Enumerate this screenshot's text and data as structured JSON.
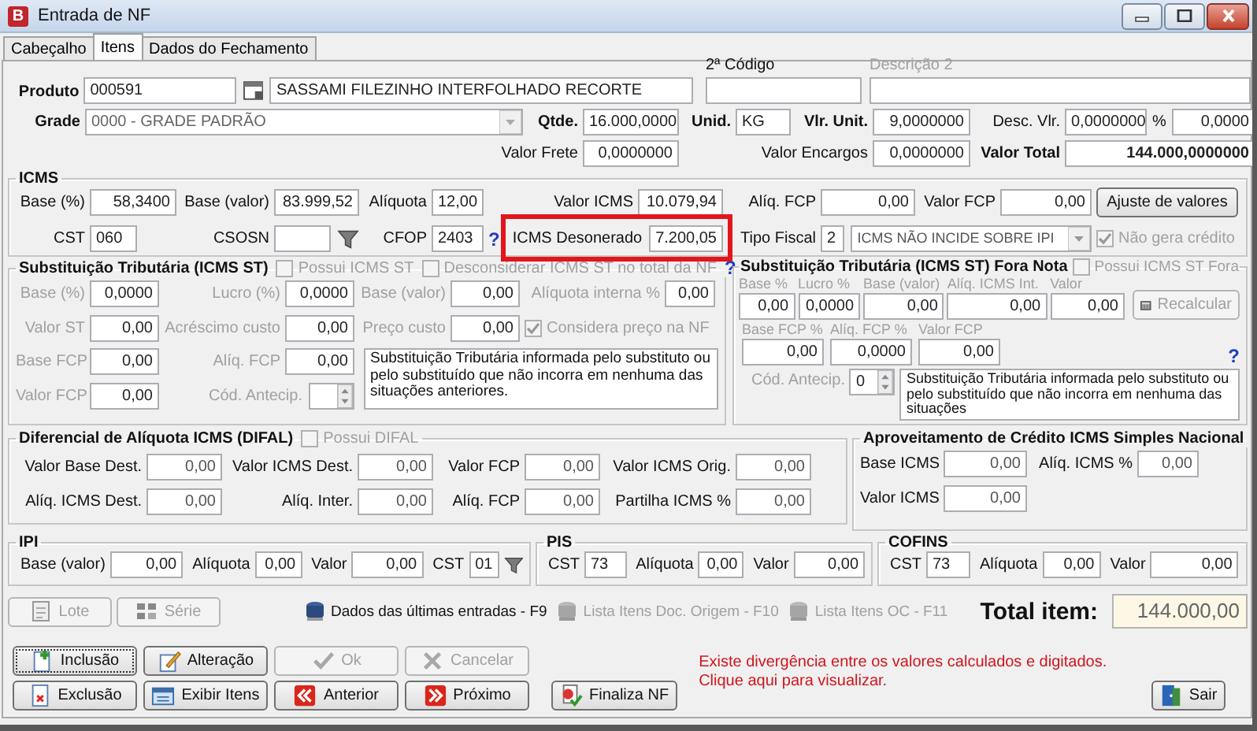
{
  "window": {
    "logo": "B",
    "title": "Entrada de NF"
  },
  "tabs": [
    {
      "label": "Cabeçalho",
      "selected": false
    },
    {
      "label": "Itens",
      "selected": true
    },
    {
      "label": "Dados do Fechamento",
      "selected": false
    }
  ],
  "produto": {
    "label": "Produto",
    "code": "000591",
    "description": "SASSAMI FILEZINHO INTERFOLHADO RECORTE"
  },
  "segundo_codigo": {
    "label": "2ª Código"
  },
  "descricao_2": {
    "label": "Descrição 2",
    "disabled": true
  },
  "grade": {
    "label": "Grade",
    "value": "0000 - GRADE PADRÃO"
  },
  "qtde": {
    "label": "Qtde.",
    "value": "16.000,0000"
  },
  "unid": {
    "label": "Unid.",
    "value": "KG"
  },
  "vlr_unit": {
    "label": "Vlr. Unit.",
    "value": "9,0000000"
  },
  "desc_vlr": {
    "label": "Desc. Vlr.",
    "value": "0,0000000"
  },
  "desc_pct": {
    "label": "%",
    "value": "0,0000"
  },
  "valor_frete": {
    "label": "Valor Frete",
    "value": "0,0000000"
  },
  "valor_encargos": {
    "label": "Valor Encargos",
    "value": "0,0000000"
  },
  "valor_total": {
    "label": "Valor Total",
    "value": "144.000,0000000"
  },
  "icms": {
    "title": "ICMS",
    "base_pct": {
      "label": "Base (%)",
      "value": "58,3400"
    },
    "base_valor": {
      "label": "Base (valor)",
      "value": "83.999,52"
    },
    "aliquota": {
      "label": "Alíquota",
      "value": "12,00"
    },
    "valor_icms": {
      "label": "Valor ICMS",
      "value": "10.079,94"
    },
    "aliq_fcp": {
      "label": "Alíq. FCP",
      "value": "0,00"
    },
    "valor_fcp": {
      "label": "Valor FCP",
      "value": "0,00"
    },
    "ajuste_button": "Ajuste de valores",
    "cst": {
      "label": "CST",
      "value": "060"
    },
    "csosn": {
      "label": "CSOSN"
    },
    "cfop": {
      "label": "CFOP",
      "value": "2403"
    },
    "help": "?",
    "icms_desonerado": {
      "label": "ICMS Desonerado",
      "value": "7.200,05",
      "highlighted": true
    },
    "tipo_fiscal": {
      "label": "Tipo Fiscal",
      "code": "2",
      "value": "ICMS NÃO INCIDE SOBRE IPI"
    },
    "nao_gera_credito": {
      "label": "Não gera crédito",
      "checked": true,
      "disabled": true
    }
  },
  "st": {
    "title": "Substituição Tributária (ICMS ST)",
    "disabled": true,
    "possui": {
      "label": "Possui ICMS ST",
      "checked": false,
      "disabled": true
    },
    "desconsiderar": {
      "label": "Desconsiderar ICMS ST no total da NF",
      "checked": false,
      "disabled": true
    },
    "help": "?",
    "rows": [
      [
        {
          "label": "Base (%)",
          "value": "0,0000"
        },
        {
          "label": "Lucro (%)",
          "value": "0,0000"
        },
        {
          "label": "Base (valor)",
          "value": "0,00"
        },
        {
          "label": "Alíquota interna %",
          "value": "0,00"
        }
      ],
      [
        {
          "label": "Valor ST",
          "value": "0,00"
        },
        {
          "label": "Acréscimo custo",
          "value": "0,00"
        },
        {
          "label": "Preço custo",
          "value": "0,00"
        }
      ],
      [
        {
          "label": "Base FCP",
          "value": "0,00"
        },
        {
          "label": "Alíq. FCP",
          "value": "0,00"
        }
      ],
      [
        {
          "label": "Valor FCP",
          "value": "0,00"
        }
      ]
    ],
    "considera": {
      "label": "Considera preço na NF",
      "checked": true,
      "disabled": true
    },
    "cod_antecip": {
      "label": "Cód. Antecip."
    },
    "memo": "Substituição Tributária informada pelo substituto ou pelo substituído que não incorra em nenhuma das situações anteriores."
  },
  "st_fora": {
    "title": "Substituição Tributária (ICMS ST) Fora Nota",
    "possui": {
      "label": "Possui ICMS ST Fora",
      "checked": false,
      "disabled": true
    },
    "row1": [
      {
        "label": "Base %",
        "value": "0,00"
      },
      {
        "label": "Lucro %",
        "value": "0,0000"
      },
      {
        "label": "Base (valor)",
        "value": "0,00"
      },
      {
        "label": "Alíq. ICMS Int.",
        "value": "0,00"
      },
      {
        "label": "Valor",
        "value": "0,00"
      }
    ],
    "recalcular": {
      "label": "Recalcular",
      "disabled": true
    },
    "row2": [
      {
        "label": "Base FCP %",
        "value": "0,00"
      },
      {
        "label": "Alíq. FCP %",
        "value": "0,0000"
      },
      {
        "label": "Valor FCP",
        "value": "0,00"
      }
    ],
    "help": "?",
    "cod_antecip": {
      "label": "Cód. Antecip.",
      "value": "0"
    },
    "memo": "Substituição Tributária informada pelo substituto ou pelo substituído que não incorra em nenhuma das situações"
  },
  "difal": {
    "title": "Diferencial de Alíquota ICMS (DIFAL)",
    "possui": {
      "label": "Possui DIFAL",
      "checked": false,
      "disabled": true
    },
    "rows": [
      [
        {
          "label": "Valor Base Dest.",
          "value": "0,00"
        },
        {
          "label": "Valor ICMS Dest.",
          "value": "0,00"
        },
        {
          "label": "Valor FCP",
          "value": "0,00"
        },
        {
          "label": "Valor ICMS Orig.",
          "value": "0,00"
        }
      ],
      [
        {
          "label": "Alíq. ICMS Dest.",
          "value": "0,00"
        },
        {
          "label": "Alíq. Inter.",
          "value": "0,00"
        },
        {
          "label": "Alíq. FCP",
          "value": "0,00"
        },
        {
          "label": "Partilha ICMS %",
          "value": "0,00"
        }
      ]
    ]
  },
  "simples": {
    "title": "Aproveitamento de Crédito ICMS Simples Nacional",
    "rows": [
      [
        {
          "label": "Base ICMS",
          "value": "0,00"
        },
        {
          "label": "Alíq. ICMS %",
          "value": "0,00"
        }
      ],
      [
        {
          "label": "Valor ICMS",
          "value": "0,00"
        }
      ]
    ]
  },
  "ipi": {
    "title": "IPI",
    "fields": [
      {
        "label": "Base (valor)",
        "value": "0,00"
      },
      {
        "label": "Alíquota",
        "value": "0,00"
      },
      {
        "label": "Valor",
        "value": "0,00"
      },
      {
        "label": "CST",
        "value": "01"
      }
    ]
  },
  "pis": {
    "title": "PIS",
    "fields": [
      {
        "label": "CST",
        "value": "73"
      },
      {
        "label": "Alíquota",
        "value": "0,00"
      },
      {
        "label": "Valor",
        "value": "0,00"
      }
    ]
  },
  "cofins": {
    "title": "COFINS",
    "fields": [
      {
        "label": "CST",
        "value": "73"
      },
      {
        "label": "Alíquota",
        "value": "0,00"
      },
      {
        "label": "Valor",
        "value": "0,00"
      }
    ]
  },
  "aux_buttons": [
    {
      "label": "Lote",
      "disabled": true
    },
    {
      "label": "Série",
      "disabled": true
    }
  ],
  "links": [
    {
      "label": "Dados das últimas entradas - F9",
      "disabled": false
    },
    {
      "label": "Lista Itens Doc. Origem - F10",
      "disabled": true
    },
    {
      "label": "Lista Itens OC - F11",
      "disabled": true
    }
  ],
  "total_item": {
    "label": "Total item:",
    "value": "144.000,00"
  },
  "actions": [
    {
      "label": "Inclusão",
      "disabled": false,
      "focused": true
    },
    {
      "label": "Alteração",
      "disabled": false,
      "focused": false
    },
    {
      "label": "Ok",
      "disabled": true,
      "focused": false
    },
    {
      "label": "Cancelar",
      "disabled": true,
      "focused": false
    },
    {
      "label": "Exclusão",
      "disabled": false,
      "focused": false
    },
    {
      "label": "Exibir Itens",
      "disabled": false,
      "focused": false
    },
    {
      "label": "Anterior",
      "disabled": false,
      "focused": false
    },
    {
      "label": "Próximo",
      "disabled": false,
      "focused": false
    }
  ],
  "finaliza": {
    "label": "Finaliza NF"
  },
  "message": [
    "Existe divergência entre os valores calculados e digitados.",
    "Clique aqui para visualizar."
  ],
  "sair": {
    "label": "Sair"
  }
}
